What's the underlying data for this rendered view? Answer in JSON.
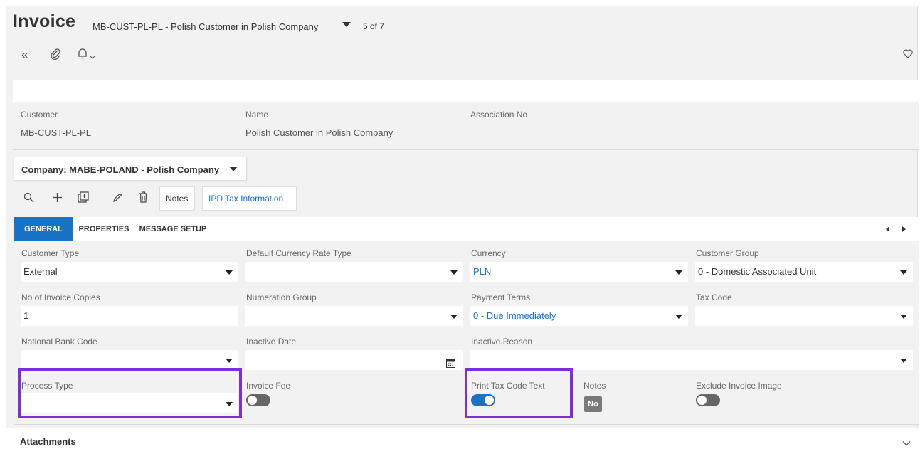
{
  "header": {
    "title": "Invoice",
    "subtitle": "MB-CUST-PL-PL - Polish Customer in Polish Company",
    "pager": "5 of 7",
    "icons": [
      "double-chevron-left-icon",
      "paperclip-icon",
      "bell-icon",
      "chevron-down-icon",
      "heart-icon"
    ]
  },
  "summary": {
    "customer_label": "Customer",
    "customer_value": "MB-CUST-PL-PL",
    "name_label": "Name",
    "name_value": "Polish Customer in Polish Company",
    "association_label": "Association No",
    "association_value": ""
  },
  "company": {
    "label": "Company: MABE-POLAND - Polish Company"
  },
  "toolbar": {
    "notes_label": "Notes",
    "ipd_label": "IPD Tax Information",
    "icons": [
      "search-icon",
      "plus-icon",
      "copy-icon",
      "edit-icon",
      "trash-icon"
    ]
  },
  "tabs": [
    {
      "label": "GENERAL",
      "active": true
    },
    {
      "label": "PROPERTIES",
      "active": false
    },
    {
      "label": "MESSAGE SETUP",
      "active": false
    }
  ],
  "fields": {
    "customer_type": {
      "label": "Customer Type",
      "value": "External"
    },
    "default_currency_rate_type": {
      "label": "Default Currency Rate Type",
      "value": ""
    },
    "currency": {
      "label": "Currency",
      "value": "PLN"
    },
    "customer_group": {
      "label": "Customer Group",
      "value": "0 - Domestic Associated Unit"
    },
    "no_of_invoice_copies": {
      "label": "No of Invoice Copies",
      "value": "1"
    },
    "numeration_group": {
      "label": "Numeration Group",
      "value": ""
    },
    "payment_terms": {
      "label": "Payment Terms",
      "value": "0 - Due Immediately"
    },
    "tax_code": {
      "label": "Tax Code",
      "value": ""
    },
    "national_bank_code": {
      "label": "National Bank Code",
      "value": ""
    },
    "inactive_date": {
      "label": "Inactive Date",
      "value": ""
    },
    "inactive_reason": {
      "label": "Inactive Reason",
      "value": ""
    },
    "process_type": {
      "label": "Process Type",
      "value": ""
    },
    "invoice_fee": {
      "label": "Invoice Fee",
      "on": false
    },
    "print_tax_code_text": {
      "label": "Print Tax Code Text",
      "on": true
    },
    "notes": {
      "label": "Notes",
      "badge": "No"
    },
    "exclude_invoice_image": {
      "label": "Exclude Invoice Image",
      "on": false
    }
  },
  "attachments": {
    "label": "Attachments"
  },
  "colors": {
    "accent": "#1a72c7",
    "highlight": "#7b2fd6",
    "background": "#f2f2f2"
  }
}
